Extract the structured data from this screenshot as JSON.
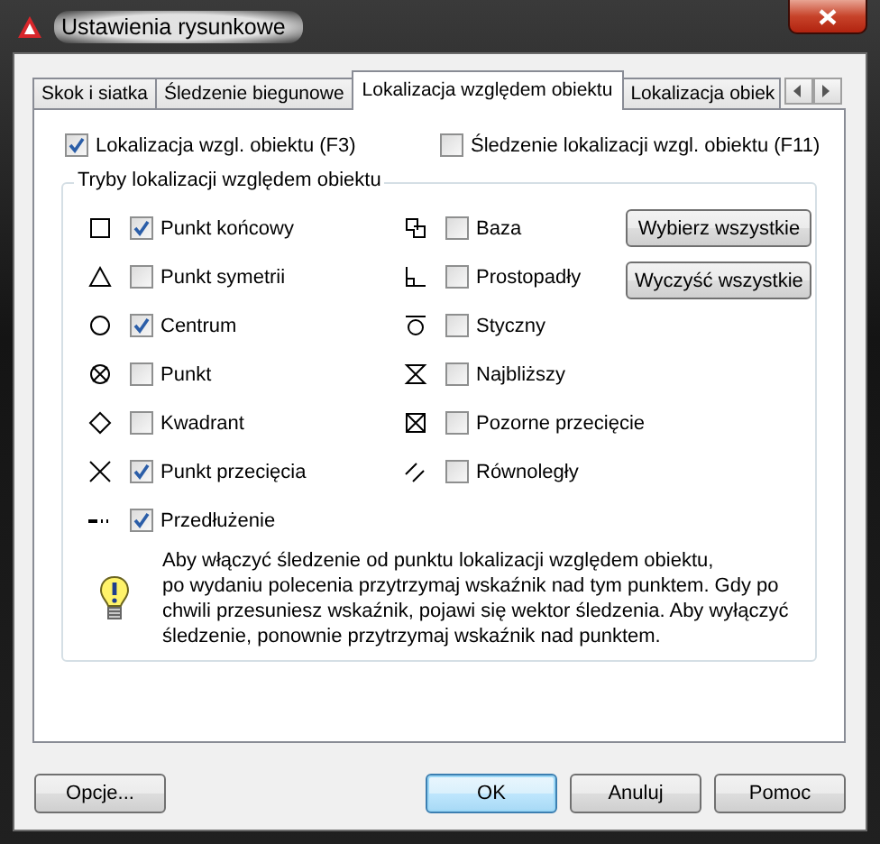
{
  "window": {
    "title": "Ustawienia rysunkowe"
  },
  "tabs": [
    {
      "label": "Skok i siatka",
      "selected": false
    },
    {
      "label": "Śledzenie biegunowe",
      "selected": false
    },
    {
      "label": "Lokalizacja względem obiektu",
      "selected": true
    },
    {
      "label": "Lokalizacja obiek",
      "selected": false
    }
  ],
  "top_options": [
    {
      "label": "Lokalizacja wzgl. obiektu (F3)",
      "checked": true
    },
    {
      "label": "Śledzenie lokalizacji wzgl. obiektu (F11)",
      "checked": false
    }
  ],
  "group": {
    "title": "Tryby lokalizacji względem obiektu",
    "left_modes": [
      {
        "label": "Punkt końcowy",
        "checked": true
      },
      {
        "label": "Punkt symetrii",
        "checked": false
      },
      {
        "label": "Centrum",
        "checked": true
      },
      {
        "label": "Punkt",
        "checked": false
      },
      {
        "label": "Kwadrant",
        "checked": false
      },
      {
        "label": "Punkt przecięcia",
        "checked": true
      },
      {
        "label": "Przedłużenie",
        "checked": true
      }
    ],
    "right_modes": [
      {
        "label": "Baza",
        "checked": false
      },
      {
        "label": "Prostopadły",
        "checked": false
      },
      {
        "label": "Styczny",
        "checked": false
      },
      {
        "label": "Najbliższy",
        "checked": false
      },
      {
        "label": "Pozorne przecięcie",
        "checked": false
      },
      {
        "label": "Równoległy",
        "checked": false
      }
    ],
    "buttons": [
      "Wybierz wszystkie",
      "Wyczyść wszystkie"
    ],
    "hint": "Aby włączyć śledzenie od punktu lokalizacji względem obiektu,\npo wydaniu polecenia przytrzymaj wskaźnik nad tym punktem. Gdy po\nchwili przesuniesz wskaźnik, pojawi się wektor śledzenia. Aby wyłączyć\nśledzenie, ponownie przytrzymaj wskaźnik nad punktem."
  },
  "buttons": [
    {
      "label": "Opcje...",
      "default": false
    },
    {
      "label": "OK",
      "default": true
    },
    {
      "label": "Anuluj",
      "default": false
    },
    {
      "label": "Pomoc",
      "default": false
    }
  ]
}
